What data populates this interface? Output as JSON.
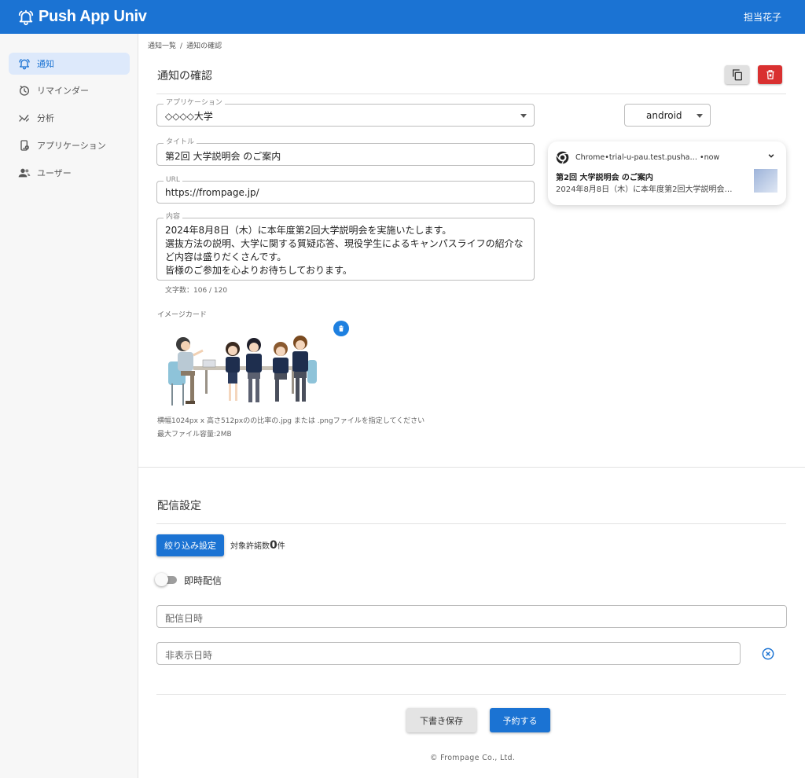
{
  "header": {
    "app_title": "Push App Univ",
    "user_name": "担当花子"
  },
  "sidebar": {
    "items": [
      {
        "label": "通知",
        "icon": "bell-icon",
        "active": true
      },
      {
        "label": "リマインダー",
        "icon": "timer-icon"
      },
      {
        "label": "分析",
        "icon": "analytics-icon"
      },
      {
        "label": "アプリケーション",
        "icon": "app-icon"
      },
      {
        "label": "ユーザー",
        "icon": "users-icon"
      }
    ]
  },
  "breadcrumb": [
    "通知一覧",
    "通知の確認"
  ],
  "breadcrumb_separator": "/",
  "page": {
    "title": "通知の確認"
  },
  "form": {
    "application": {
      "label": "アプリケーション",
      "value": "◇◇◇◇大学"
    },
    "title": {
      "label": "タイトル",
      "value": "第2回 大学説明会 のご案内"
    },
    "url": {
      "label": "URL",
      "value": "https://frompage.jp/"
    },
    "content": {
      "label": "内容",
      "lines": [
        "2024年8月8日（木）に本年度第2回大学説明会を実施いたします。",
        "選抜方法の説明、大学に関する質疑応答、現役学生によるキャンパスライフの紹介な",
        "ど内容は盛りだくさんです。",
        "皆様のご参加を心よりお待ちしております。"
      ]
    },
    "char_count": "文字数：106 / 120",
    "image_card": {
      "label": "イメージカード",
      "hint": "横幅1024px x 高さ512pxのの比率の.jpg または .pngファイルを指定してください",
      "max_size": "最大ファイル容量:2MB"
    }
  },
  "preview": {
    "platform": "android",
    "source": "Chrome•trial-u-pau.test.pusha… •now",
    "title": "第2回 大学説明会 のご案内",
    "body": "2024年8月8日（木）に本年度第2回大学説明会…"
  },
  "delivery": {
    "section_title": "配信設定",
    "filter_button": "絞り込み設定",
    "target_prefix": "対象許諾数",
    "target_count": "0",
    "target_suffix": "件",
    "instant_label": "即時配信",
    "instant_on": false,
    "datetime_placeholder": "配信日時",
    "hide_datetime_placeholder": "非表示日時"
  },
  "actions": {
    "draft": "下書き保存",
    "reserve": "予約する"
  },
  "footer": "© Frompage Co., Ltd.",
  "colors": {
    "primary": "#1b73d3",
    "danger": "#d93030",
    "sidebar_active_bg": "#dde9fb"
  }
}
